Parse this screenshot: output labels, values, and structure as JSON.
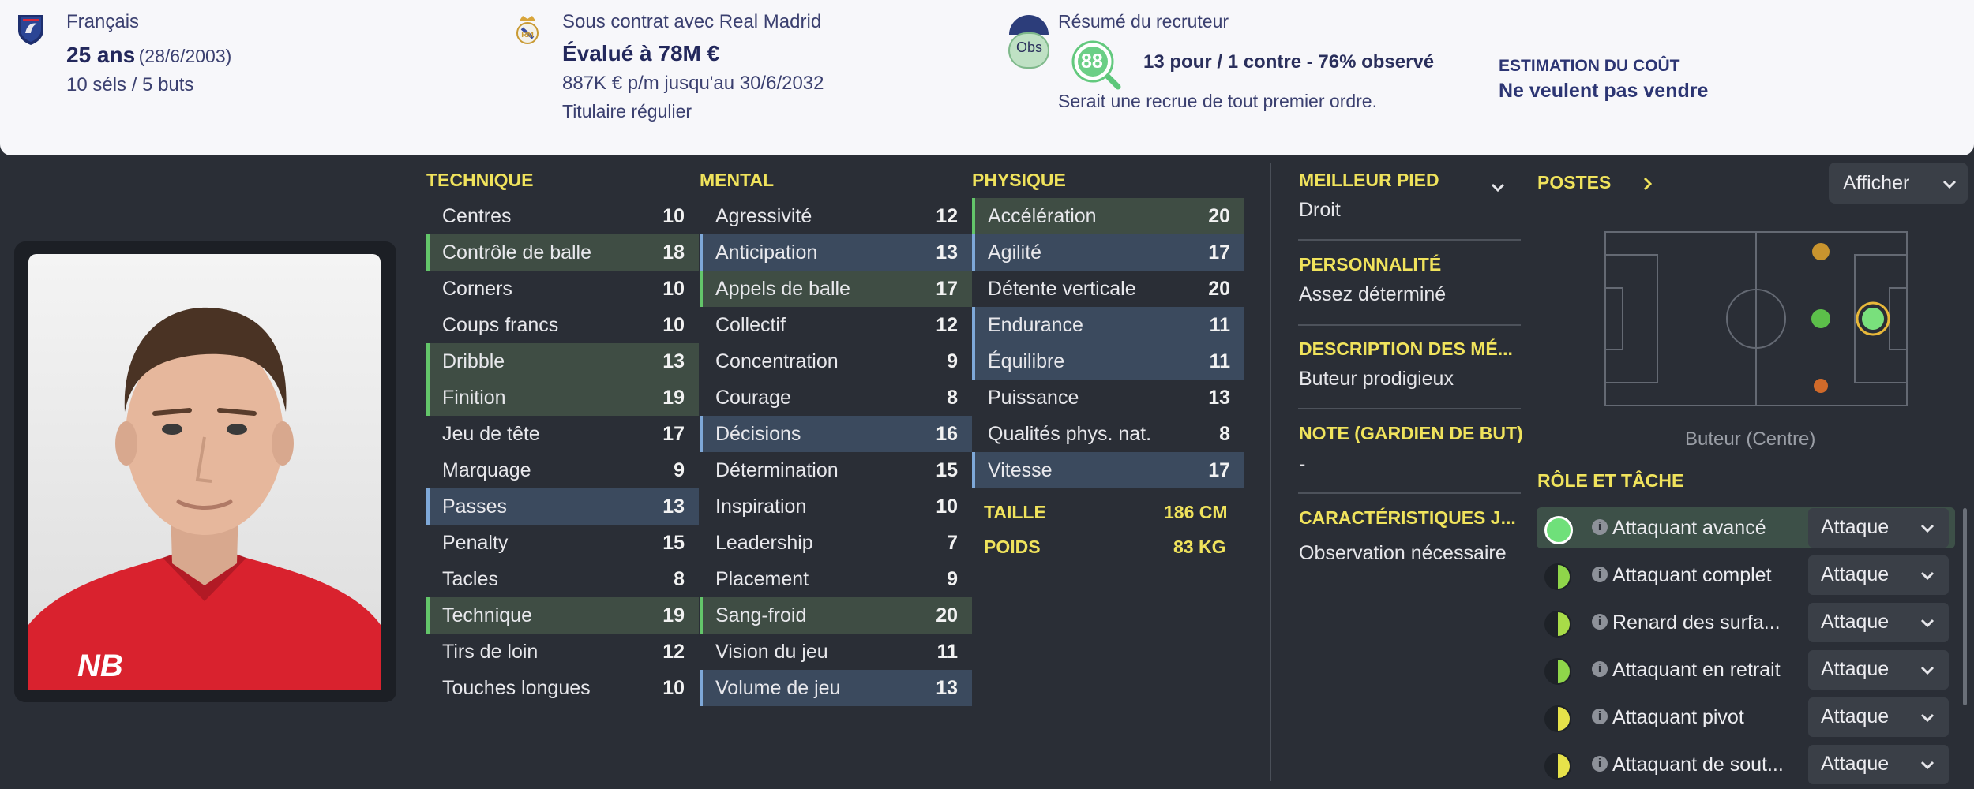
{
  "header": {
    "nationality": "Français",
    "age_label": "25 ans",
    "birth_date": "(28/6/2003)",
    "caps_goals": "10 séls / 5 buts",
    "contract_label": "Sous contrat avec Real Madrid",
    "value_label": "Évalué à 78M €",
    "wage_label": "887K € p/m jusqu'au 30/6/2032",
    "squad_status": "Titulaire régulier",
    "scout_summary_title": "Résumé du recruteur",
    "obs_badge": "Obs",
    "scout_rating": "88",
    "scout_votes": "13 pour / 1 contre - 76% observé",
    "scout_verdict": "Serait une recrue de tout premier ordre.",
    "cost_title": "ESTIMATION DU COÛT",
    "cost_value": "Ne veulent pas vendre"
  },
  "technique": {
    "title": "TECHNIQUE",
    "rows": [
      {
        "name": "Centres",
        "value": "10",
        "hl": "",
        "color": "white"
      },
      {
        "name": "Contrôle de balle",
        "value": "18",
        "hl": "g",
        "color": "green"
      },
      {
        "name": "Corners",
        "value": "10",
        "hl": "",
        "color": "white"
      },
      {
        "name": "Coups francs",
        "value": "10",
        "hl": "",
        "color": "white"
      },
      {
        "name": "Dribble",
        "value": "13",
        "hl": "g",
        "color": "yellow"
      },
      {
        "name": "Finition",
        "value": "19",
        "hl": "g",
        "color": "green"
      },
      {
        "name": "Jeu de tête",
        "value": "17",
        "hl": "",
        "color": "green"
      },
      {
        "name": "Marquage",
        "value": "9",
        "hl": "",
        "color": "white"
      },
      {
        "name": "Passes",
        "value": "13",
        "hl": "b",
        "color": "yellow"
      },
      {
        "name": "Penalty",
        "value": "15",
        "hl": "",
        "color": "yellow"
      },
      {
        "name": "Tacles",
        "value": "8",
        "hl": "",
        "color": "white"
      },
      {
        "name": "Technique",
        "value": "19",
        "hl": "g",
        "color": "green"
      },
      {
        "name": "Tirs de loin",
        "value": "12",
        "hl": "",
        "color": "yellow"
      },
      {
        "name": "Touches longues",
        "value": "10",
        "hl": "",
        "color": "white"
      }
    ]
  },
  "mental": {
    "title": "MENTAL",
    "rows": [
      {
        "name": "Agressivité",
        "value": "12",
        "hl": "",
        "color": "yellow"
      },
      {
        "name": "Anticipation",
        "value": "13",
        "hl": "b",
        "color": "yellow"
      },
      {
        "name": "Appels de balle",
        "value": "17",
        "hl": "g",
        "color": "green"
      },
      {
        "name": "Collectif",
        "value": "12",
        "hl": "",
        "color": "yellow"
      },
      {
        "name": "Concentration",
        "value": "9",
        "hl": "",
        "color": "white"
      },
      {
        "name": "Courage",
        "value": "8",
        "hl": "",
        "color": "white"
      },
      {
        "name": "Décisions",
        "value": "16",
        "hl": "b",
        "color": "green"
      },
      {
        "name": "Détermination",
        "value": "15",
        "hl": "",
        "color": "yellow"
      },
      {
        "name": "Inspiration",
        "value": "10",
        "hl": "",
        "color": "white"
      },
      {
        "name": "Leadership",
        "value": "7",
        "hl": "",
        "color": "white"
      },
      {
        "name": "Placement",
        "value": "9",
        "hl": "",
        "color": "white"
      },
      {
        "name": "Sang-froid",
        "value": "20",
        "hl": "g",
        "color": "green"
      },
      {
        "name": "Vision du jeu",
        "value": "11",
        "hl": "",
        "color": "yellow"
      },
      {
        "name": "Volume de jeu",
        "value": "13",
        "hl": "b",
        "color": "yellow"
      }
    ]
  },
  "physique": {
    "title": "PHYSIQUE",
    "rows": [
      {
        "name": "Accélération",
        "value": "20",
        "hl": "g",
        "color": "green"
      },
      {
        "name": "Agilité",
        "value": "17",
        "hl": "b",
        "color": "green"
      },
      {
        "name": "Détente verticale",
        "value": "20",
        "hl": "",
        "color": "green"
      },
      {
        "name": "Endurance",
        "value": "11",
        "hl": "b",
        "color": "yellow"
      },
      {
        "name": "Équilibre",
        "value": "11",
        "hl": "b",
        "color": "yellow"
      },
      {
        "name": "Puissance",
        "value": "13",
        "hl": "",
        "color": "yellow"
      },
      {
        "name": "Qualités phys. nat.",
        "value": "8",
        "hl": "",
        "color": "white"
      },
      {
        "name": "Vitesse",
        "value": "17",
        "hl": "b",
        "color": "green"
      }
    ],
    "height_label": "TAILLE",
    "height_value": "186 CM",
    "weight_label": "POIDS",
    "weight_value": "83 KG"
  },
  "info": {
    "foot_title": "MEILLEUR PIED",
    "foot_value": "Droit",
    "personality_title": "PERSONNALITÉ",
    "personality_value": "Assez déterminé",
    "media_title": "DESCRIPTION DES MÉ...",
    "media_value": "Buteur prodigieux",
    "gk_title": "NOTE (GARDIEN DE BUT)",
    "gk_value": "-",
    "traits_title": "CARACTÉRISTIQUES J...",
    "traits_value": "Observation nécessaire"
  },
  "positions": {
    "title": "POSTES",
    "view_button": "Afficher",
    "position_label": "Buteur (Centre)"
  },
  "roles": {
    "title": "RÔLE ET TÂCHE",
    "items": [
      {
        "name": "Attaquant avancé",
        "duty": "Attaque",
        "dot": "full"
      },
      {
        "name": "Attaquant complet",
        "duty": "Attaque",
        "dot": "half-green"
      },
      {
        "name": "Renard des surfa...",
        "duty": "Attaque",
        "dot": "half-lime"
      },
      {
        "name": "Attaquant en retrait",
        "duty": "Attaque",
        "dot": "half-green"
      },
      {
        "name": "Attaquant pivot",
        "duty": "Attaque",
        "dot": "half-yellow"
      },
      {
        "name": "Attaquant de sout...",
        "duty": "Attaque",
        "dot": "half-yellow"
      }
    ]
  },
  "colors": {
    "accent_yellow": "#f0e35c",
    "rating_green": "#7ee07a",
    "rating_yellow": "#eedc4e",
    "background": "#2a2e36"
  }
}
